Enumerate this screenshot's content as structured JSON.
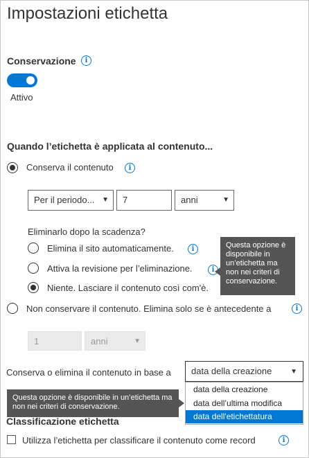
{
  "page": {
    "title": "Impostazioni etichetta"
  },
  "retention": {
    "heading": "Conservazione",
    "toggle_state": "Attivo"
  },
  "applied": {
    "heading": "Quando l’etichetta è applicata al contenuto..."
  },
  "keep": {
    "label": "Conserva il contenuto",
    "period_select": "Per il periodo...",
    "period_value": "7",
    "unit_select": "anni",
    "delete_after_label": "Eliminarlo dopo la scadenza?",
    "options": [
      "Elimina il sito automaticamente.",
      "Attiva la revisione per l’eliminazione.",
      "Niente. Lasciare il contenuto così com'è."
    ]
  },
  "tooltip1": "Questa opzione è disponibile in un’etichetta ma non nei criteri di conservazione.",
  "dont_keep": {
    "label": "Non conservare il contenuto. Elimina solo se è antecedente a",
    "value": "1",
    "unit": "anni"
  },
  "based_on": {
    "label": "Conserva o elimina il contenuto in base a",
    "selected": "data della creazione",
    "options": [
      "data della creazione",
      "data dell’ultima modifica",
      "data dell'etichettatura"
    ]
  },
  "tooltip2": "Questa opzione è disponibile in un’etichetta ma non nei criteri di conservazione.",
  "classification": {
    "heading": "Classificazione etichetta",
    "checkbox_label": "Utilizza l’etichetta per classificare il contenuto come record"
  },
  "icons": {
    "info": "info-icon",
    "caret": "chevron-down-icon"
  },
  "colors": {
    "accent": "#0078d4",
    "tooltip_bg": "#555555",
    "selected_item": "#0078d4"
  }
}
